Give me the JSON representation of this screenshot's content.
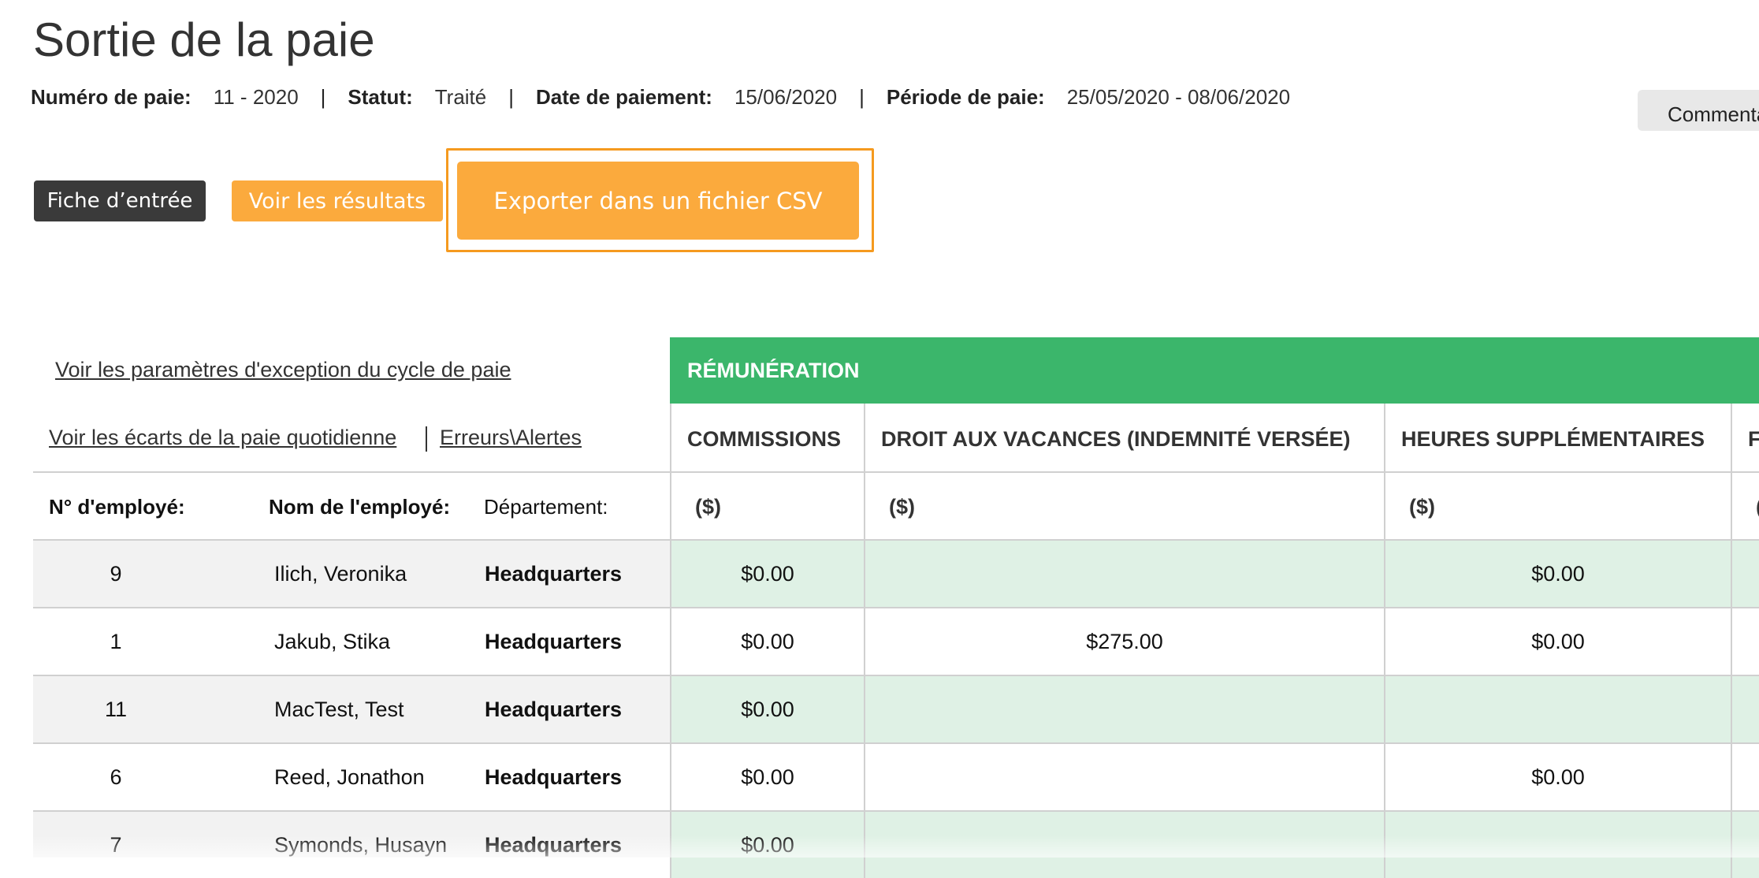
{
  "page": {
    "title": "Sortie de la paie"
  },
  "meta": {
    "pay_number_label": "Numéro de paie:",
    "pay_number_value": "11 - 2020",
    "status_label": "Statut:",
    "status_value": "Traité",
    "pay_date_label": "Date de paiement:",
    "pay_date_value": "15/06/2020",
    "pay_period_label": "Période de paie:",
    "pay_period_value": "25/05/2020 - 08/06/2020",
    "separator": "|"
  },
  "toolbar": {
    "comment_label": "Commenta",
    "entry_sheet_label": "Fiche d’entrée",
    "view_results_label": "Voir les résultats",
    "export_csv_label": "Exporter dans un fichier CSV"
  },
  "links": {
    "exception_params": "Voir les paramètres d'exception du cycle de paie",
    "daily_variances": "Voir les écarts de la paie quotidienne",
    "errors_alerts": "Erreurs\\Alertes"
  },
  "table": {
    "section_title": "RÉMUNÉRATION",
    "left_headers": {
      "employee_number": "N° d'employé:",
      "employee_name": "Nom de l'employé:",
      "department": "Département:"
    },
    "columns": [
      {
        "title": "COMMISSIONS",
        "unit": "($)"
      },
      {
        "title": "DROIT AUX VACANCES (INDEMNITÉ VERSÉE)",
        "unit": "($)"
      },
      {
        "title": "HEURES SUPPLÉMENTAIRES",
        "unit": "($)"
      },
      {
        "title": "F",
        "unit": "("
      }
    ],
    "rows": [
      {
        "num": "9",
        "name": "Ilich, Veronika",
        "dept": "Headquarters",
        "commissions": "$0.00",
        "vacation": "",
        "overtime": "$0.00"
      },
      {
        "num": "1",
        "name": "Jakub, Stika",
        "dept": "Headquarters",
        "commissions": "$0.00",
        "vacation": "$275.00",
        "overtime": "$0.00"
      },
      {
        "num": "11",
        "name": "MacTest, Test",
        "dept": "Headquarters",
        "commissions": "$0.00",
        "vacation": "",
        "overtime": ""
      },
      {
        "num": "6",
        "name": "Reed, Jonathon",
        "dept": "Headquarters",
        "commissions": "$0.00",
        "vacation": "",
        "overtime": "$0.00"
      },
      {
        "num": "7",
        "name": "Symonds, Husayn",
        "dept": "Headquarters",
        "commissions": "$0.00",
        "vacation": "",
        "overtime": ""
      }
    ]
  },
  "colors": {
    "section_green": "#3bb66b",
    "cell_green": "#dff1e5",
    "accent_orange": "#fbaa3d",
    "highlight_orange": "#f59a1f",
    "dark_button": "#3a3a3a"
  }
}
